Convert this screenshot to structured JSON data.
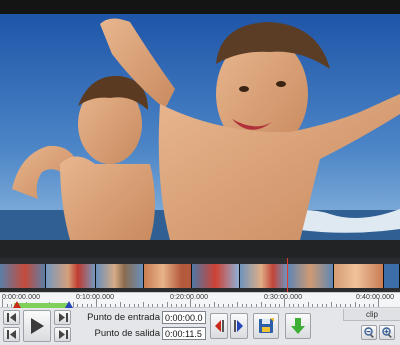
{
  "timeline": {
    "labels": [
      "0:00:00.000",
      "0:10:00.000",
      "0:20:00.000",
      "0:30:00.000",
      "0:40:00.000"
    ]
  },
  "controls": {
    "in_point_label": "Punto de entrada",
    "in_point_value": "0:00:00.0",
    "out_point_label": "Punto de salida",
    "out_point_value": "0:00:11.5",
    "clip_tab_label": "clip"
  },
  "colors": {
    "progress_green": "#7fd15a",
    "playhead_red": "#e23a2a",
    "in_marker_red": "#c92a1a",
    "out_marker_blue": "#2446b8"
  },
  "icons": [
    "previous-frame-icon",
    "play-icon",
    "next-frame-icon",
    "go-to-end-icon",
    "set-in-point-icon",
    "set-out-point-icon",
    "save-clip-icon",
    "download-arrow-icon",
    "zoom-out-icon",
    "zoom-in-icon"
  ]
}
